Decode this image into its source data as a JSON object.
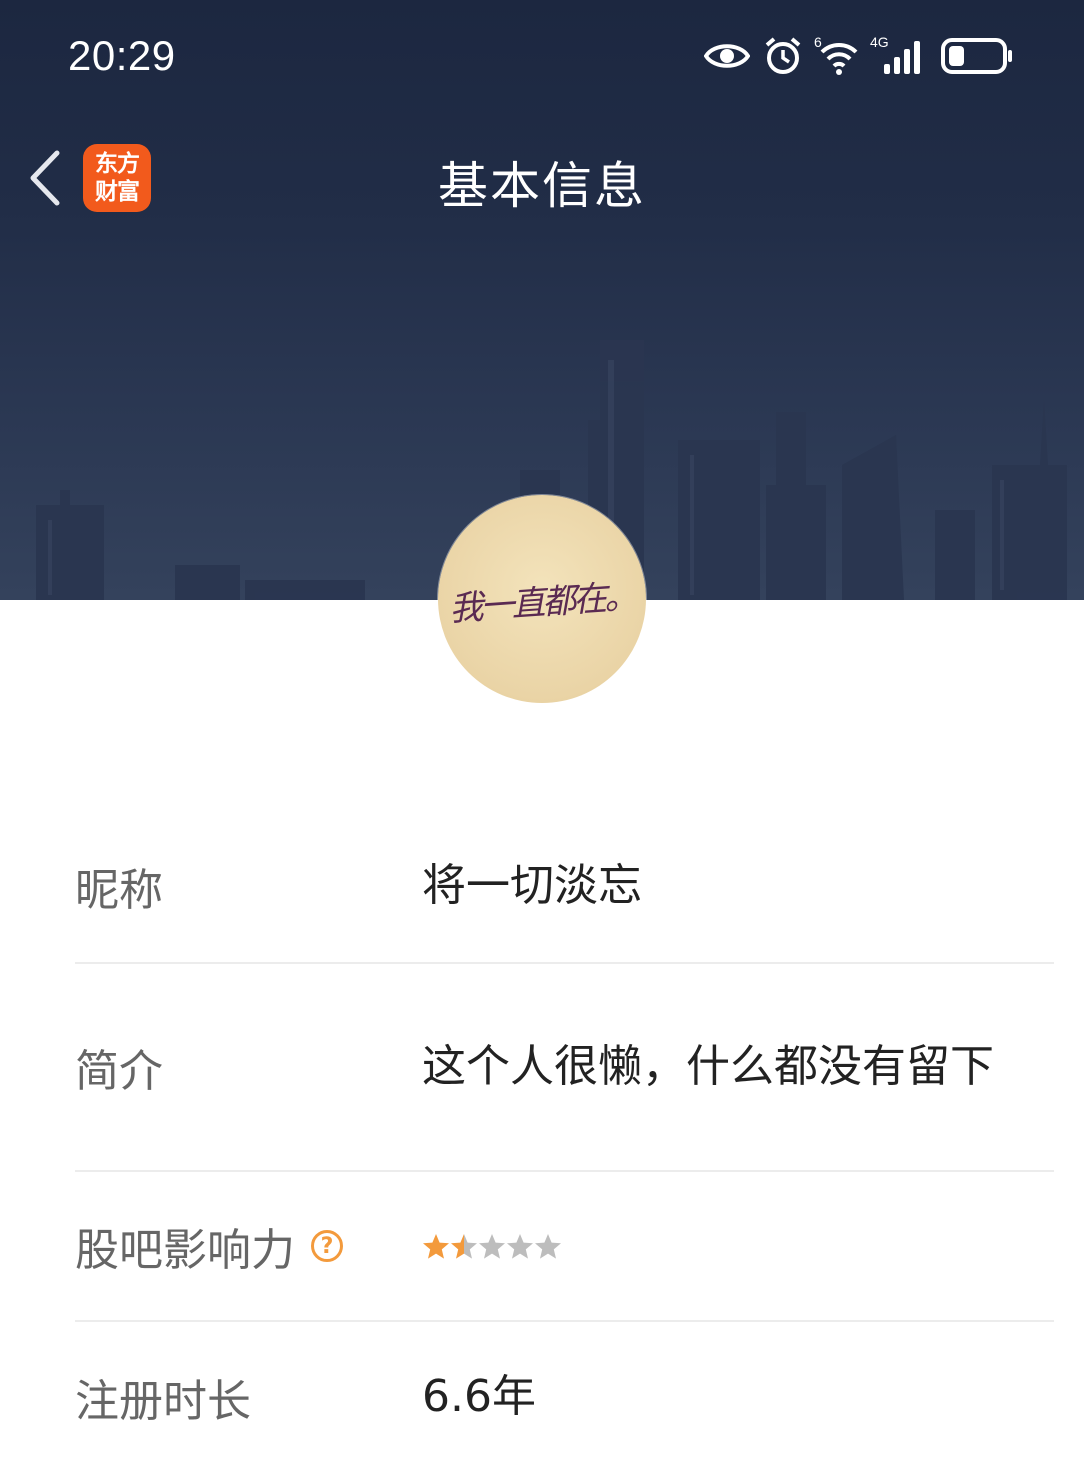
{
  "status_bar": {
    "time": "20:29",
    "icons": [
      "eye-icon",
      "alarm-icon",
      "wifi-icon",
      "cellular-4g-icon",
      "battery-icon"
    ],
    "wifi_label": "6",
    "cellular_label": "4G",
    "battery_level": 0.3
  },
  "nav": {
    "back_icon": "chevron-left-icon",
    "app_logo_line1": "东方",
    "app_logo_line2": "财富",
    "title": "基本信息"
  },
  "avatar": {
    "text": "我一直都在。"
  },
  "info": {
    "nickname_label": "昵称",
    "nickname_value": "将一切淡忘",
    "bio_label": "简介",
    "bio_value": "这个人很懒，什么都没有留下",
    "influence_label": "股吧影响力",
    "influence_help_icon": "question-circle-icon",
    "influence_rating": 1.5,
    "influence_max": 5,
    "register_label": "注册时长",
    "register_value": "6.6年"
  },
  "colors": {
    "banner": "#212d47",
    "logo": "#f25a1c",
    "star_active": "#f39a3c",
    "star_inactive": "#bdbdbd",
    "divider": "#ececec"
  }
}
